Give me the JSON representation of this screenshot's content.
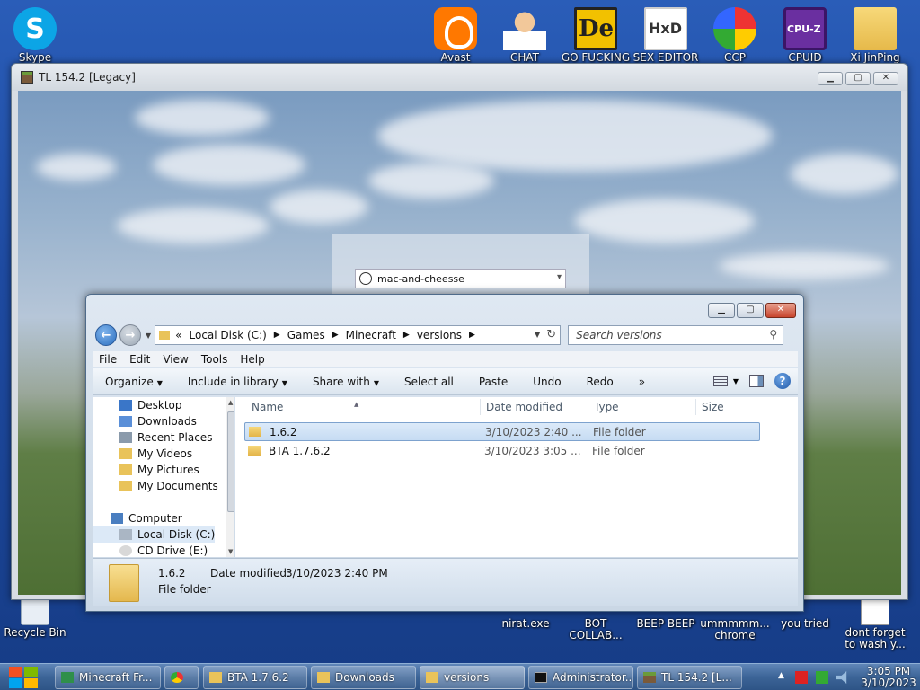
{
  "desktop": {
    "top_icons": [
      {
        "label": "Skype"
      },
      {
        "label": "Avast"
      },
      {
        "label": "CHAT"
      },
      {
        "label": "GO FUCKING"
      },
      {
        "label": "SEX EDITOR"
      },
      {
        "label": "CCP"
      },
      {
        "label": "CPUID"
      },
      {
        "label": "Xi JinPing"
      }
    ],
    "bottom_icons": [
      {
        "label": "Recycle Bin"
      },
      {
        "label": "nirat.exe"
      },
      {
        "label": "BOT COLLAB..."
      },
      {
        "label": "BEEP BEEP"
      },
      {
        "label": "ummmmm... chrome"
      },
      {
        "label": "you tried"
      },
      {
        "label": "dont forget to wash y..."
      }
    ]
  },
  "launcher": {
    "title": "TL 154.2  [Legacy]",
    "account": "mac-and-cheesse"
  },
  "explorer": {
    "address": {
      "prefix": "«",
      "crumbs": [
        "Local Disk (C:)",
        "Games",
        "Minecraft",
        "versions"
      ]
    },
    "search_placeholder": "Search versions",
    "menu": [
      "File",
      "Edit",
      "View",
      "Tools",
      "Help"
    ],
    "commands": {
      "organize": "Organize",
      "include": "Include in library",
      "share": "Share with",
      "select_all": "Select all",
      "paste": "Paste",
      "undo": "Undo",
      "redo": "Redo",
      "more": "»"
    },
    "nav": [
      {
        "label": "Desktop"
      },
      {
        "label": "Downloads"
      },
      {
        "label": "Recent Places"
      },
      {
        "label": "My Videos"
      },
      {
        "label": "My Pictures"
      },
      {
        "label": "My Documents"
      },
      {
        "label": "Computer"
      },
      {
        "label": "Local Disk (C:)"
      },
      {
        "label": "CD Drive (E:)"
      }
    ],
    "columns": {
      "name": "Name",
      "date": "Date modified",
      "type": "Type",
      "size": "Size"
    },
    "files": [
      {
        "name": "1.6.2",
        "date": "3/10/2023 2:40 ...",
        "type": "File folder"
      },
      {
        "name": "BTA 1.7.6.2",
        "date": "3/10/2023 3:05 ...",
        "type": "File folder"
      }
    ],
    "details": {
      "name": "1.6.2",
      "date_label": "Date modified:",
      "date_value": "3/10/2023 2:40 PM",
      "kind": "File folder"
    }
  },
  "taskbar": {
    "buttons": [
      {
        "label": "Minecraft Fr..."
      },
      {
        "label": ""
      },
      {
        "label": "BTA 1.7.6.2"
      },
      {
        "label": "Downloads"
      },
      {
        "label": "versions"
      },
      {
        "label": "Administrator..."
      },
      {
        "label": "TL 154.2 [L..."
      }
    ],
    "time": "3:05 PM",
    "date": "3/10/2023"
  }
}
